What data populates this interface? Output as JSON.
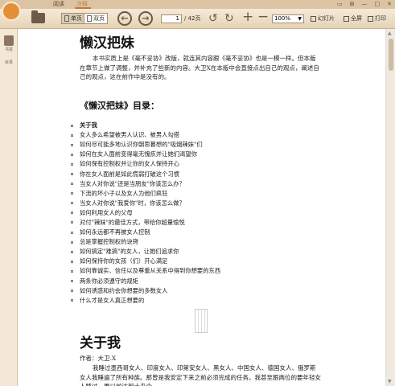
{
  "titlebar": {
    "tabs": [
      "阅读",
      "注释"
    ],
    "window_buttons": [
      "▭",
      "⊞",
      "—",
      "□",
      "✕"
    ]
  },
  "toolbar": {
    "single_page": "单页",
    "double_page": "双页",
    "prev": "←",
    "next": "→",
    "page_current": "1",
    "page_total": "/ 42页",
    "rotate_left": "↺",
    "rotate_right": "↻",
    "zoom_in": "+",
    "zoom_out": "−",
    "zoom_value": "100%",
    "slideshow": "幻灯片",
    "fullscreen": "全屏",
    "print": "打印"
  },
  "sidebar": {
    "items": [
      {
        "label": "书签",
        "icon": "book-icon"
      },
      {
        "label": "目录",
        "icon": "toc-icon"
      }
    ]
  },
  "doc": {
    "title": "懒汉把妹",
    "intro": "本书实质上是《毫不妥协》改版，就连其内容跟《毫不妥协》也是一模一样。但本版在章节上做了调整，并补充了些新的内容。大卫X在本版中会直接点出自己的观点，阐述自己的观点，这在前作中是没有的。",
    "toc_title": "《懒汉把妹》目录：",
    "toc_items": [
      "关于我",
      "女人多么希望被男人认识、被男人勾搭",
      "如何尽可能多地认识你朝思暮想的\"吸烟辣妹\"们",
      "如何在女人面前变得毫无愧疚并让她们渴望你",
      "如何保有控制权并让你的女人保持开心",
      "你在女人面前是如此慌弱打破这个习惯",
      "当女人对你说\"还是当朋友\"你该怎么办？",
      "下流的坏小子以及女人为他们疯狂",
      "当女人对你说\"我爱你\"时，你该怎么做？",
      "如何利用女人的父母",
      "对付\"辣妹\"的最佳方式，带给你超量愉悦",
      "如何永远都不再被女人控制",
      "总是掌握控制权的诀窍",
      "如何搞定\"难搞\"的女人，让她们追求你",
      "如何保持你的女孩（们）开心满足",
      "如何靠诚实、信任以及尊重从关系中得到你想要的东西",
      "两条你必须遵守的规矩",
      "如何诱惑和约会你想要的多数女人",
      "什么才是女人真正想要的"
    ],
    "section_title": "关于我",
    "author": "作者：大卫.X",
    "body": "我睡过墨西哥女人、印度女人、印第安女人、黑女人、中国女人、德国女人、俄罗斯女人我睡遍了所有种族。那曾是我安定下来之前必须完成的任务。我甚至跟两位的要年轻女人睡过，更以前达到十来个"
  }
}
